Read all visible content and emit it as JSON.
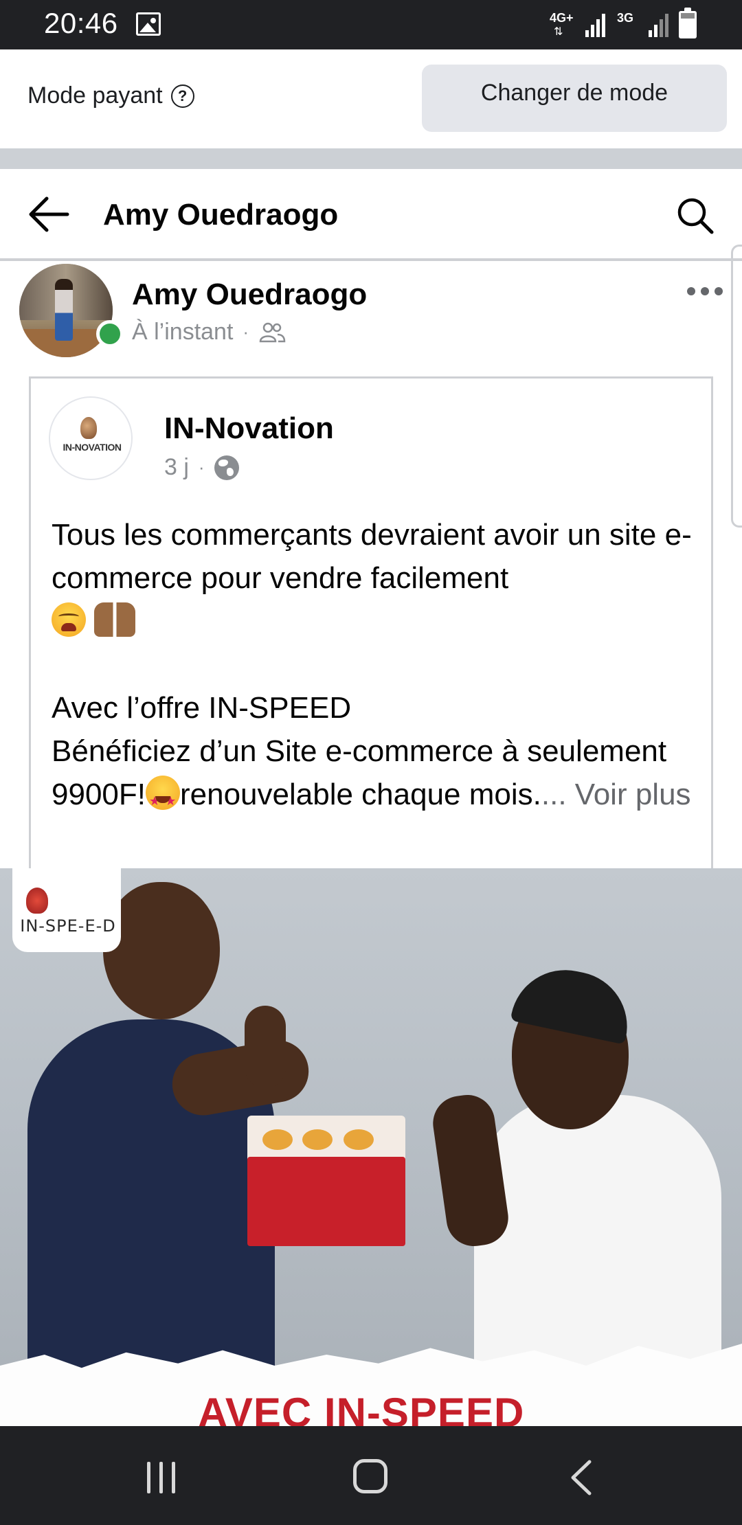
{
  "status_bar": {
    "time": "20:46",
    "network_primary": "4G+",
    "network_secondary": "3G",
    "icons": [
      "gallery-icon",
      "signal-icon",
      "signal-icon",
      "battery-icon"
    ]
  },
  "mode_bar": {
    "label": "Mode payant",
    "help_icon": "?",
    "button_label": "Changer de mode"
  },
  "header": {
    "title": "Amy Ouedraogo",
    "back_icon": "arrow-left-icon",
    "search_icon": "search-icon"
  },
  "post": {
    "author": "Amy Ouedraogo",
    "time": "À l’instant",
    "separator": "·",
    "audience_icon": "friends-icon",
    "more_icon": "more-horizontal-icon",
    "online": true
  },
  "shared_post": {
    "page_name": "IN-Novation",
    "page_logo_text": "IN-NOVATION",
    "time": "3 j",
    "separator": "·",
    "audience_icon": "globe-icon",
    "text_line_1": "Tous les commerçants devraient avoir un site e-commerce pour vendre facilement ",
    "text_line_2": "Avec l’offre IN-SPEED",
    "text_line_3a": "Bénéficiez d’un Site e-commerce à seulement 9900F!",
    "text_line_3b": "renouvelable chaque mois.",
    "see_more": "... Voir plus",
    "emojis": [
      "weary-face-emoji",
      "raising-hands-emoji",
      "star-struck-emoji"
    ]
  },
  "promo_image": {
    "logo_text": "IN-SPE-E-D",
    "headline": "AVEC IN-SPEED"
  },
  "nav_bar": {
    "icons": [
      "recents-icon",
      "home-icon",
      "back-icon"
    ]
  },
  "colors": {
    "status_bar": "#202124",
    "mode_button_bg": "#e4e6eb",
    "separator": "#ccd0d5",
    "online_dot": "#31a24c",
    "muted_text": "#8a8d91",
    "promo_headline": "#c51f2a"
  }
}
